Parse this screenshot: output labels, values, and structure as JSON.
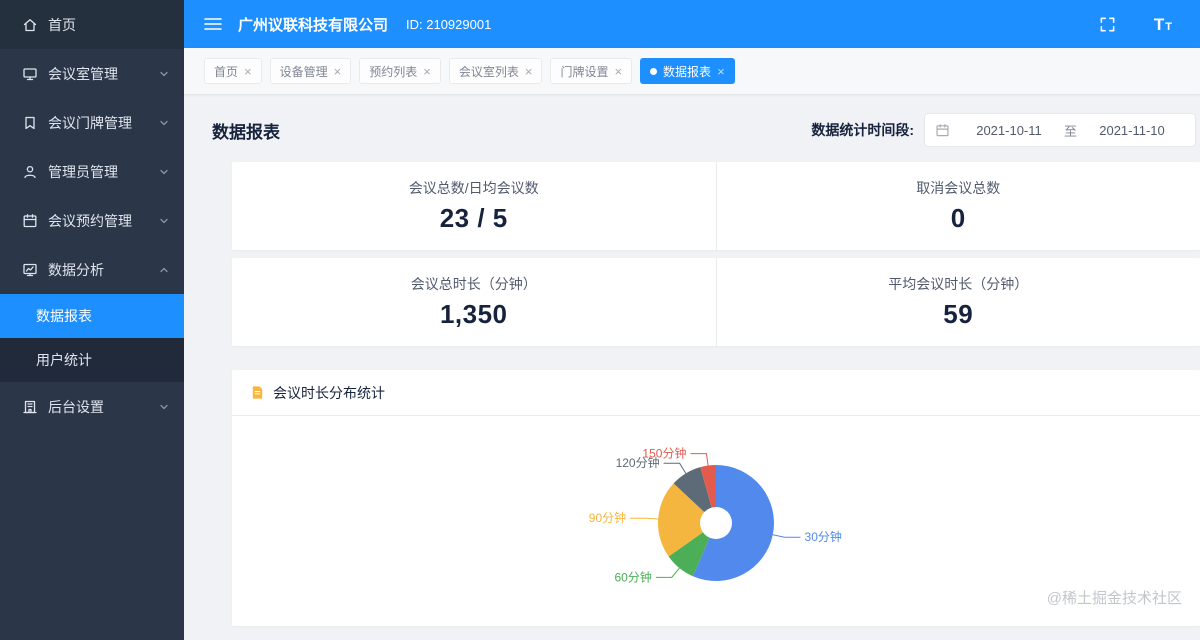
{
  "theme": {
    "primary": "#1e8fff",
    "sidebar_bg": "#2b3648",
    "content_bg": "#f0f2f5"
  },
  "header": {
    "company": "广州议联科技有限公司",
    "id_text": "ID: 210929001"
  },
  "sidebar": {
    "items": [
      {
        "label": "首页"
      },
      {
        "label": "会议室管理"
      },
      {
        "label": "会议门牌管理"
      },
      {
        "label": "管理员管理"
      },
      {
        "label": "会议预约管理"
      },
      {
        "label": "数据分析"
      },
      {
        "label": "后台设置"
      }
    ],
    "sub_items": [
      {
        "label": "数据报表"
      },
      {
        "label": "用户统计"
      }
    ]
  },
  "tabs": [
    {
      "label": "首页"
    },
    {
      "label": "设备管理"
    },
    {
      "label": "预约列表"
    },
    {
      "label": "会议室列表"
    },
    {
      "label": "门牌设置"
    },
    {
      "label": "数据报表"
    }
  ],
  "page": {
    "title": "数据报表",
    "date_filter_label": "数据统计时间段:",
    "date_start": "2021-10-11",
    "date_separator": "至",
    "date_end": "2021-11-10"
  },
  "stats": [
    {
      "label": "会议总数/日均会议数",
      "value": "23 / 5"
    },
    {
      "label": "取消会议总数",
      "value": "0"
    },
    {
      "label": "会议总时长（分钟）",
      "value": "1,350"
    },
    {
      "label": "平均会议时长（分钟）",
      "value": "59"
    }
  ],
  "chart_section": {
    "title": "会议时长分布统计"
  },
  "chart_data": {
    "type": "pie",
    "donut": true,
    "title": "会议时长分布统计",
    "legend_position": "none",
    "labels_position": "outside",
    "labels": [
      "30分钟",
      "60分钟",
      "90分钟",
      "120分钟",
      "150分钟"
    ],
    "values": [
      56.52,
      8.7,
      21.74,
      8.7,
      4.35
    ],
    "estimated_counts": [
      13,
      2,
      5,
      2,
      1
    ],
    "colors": [
      "#5189EC",
      "#4CAE57",
      "#F5B63F",
      "#5C6B77",
      "#E25B4D"
    ]
  },
  "watermark": "@稀土掘金技术社区"
}
